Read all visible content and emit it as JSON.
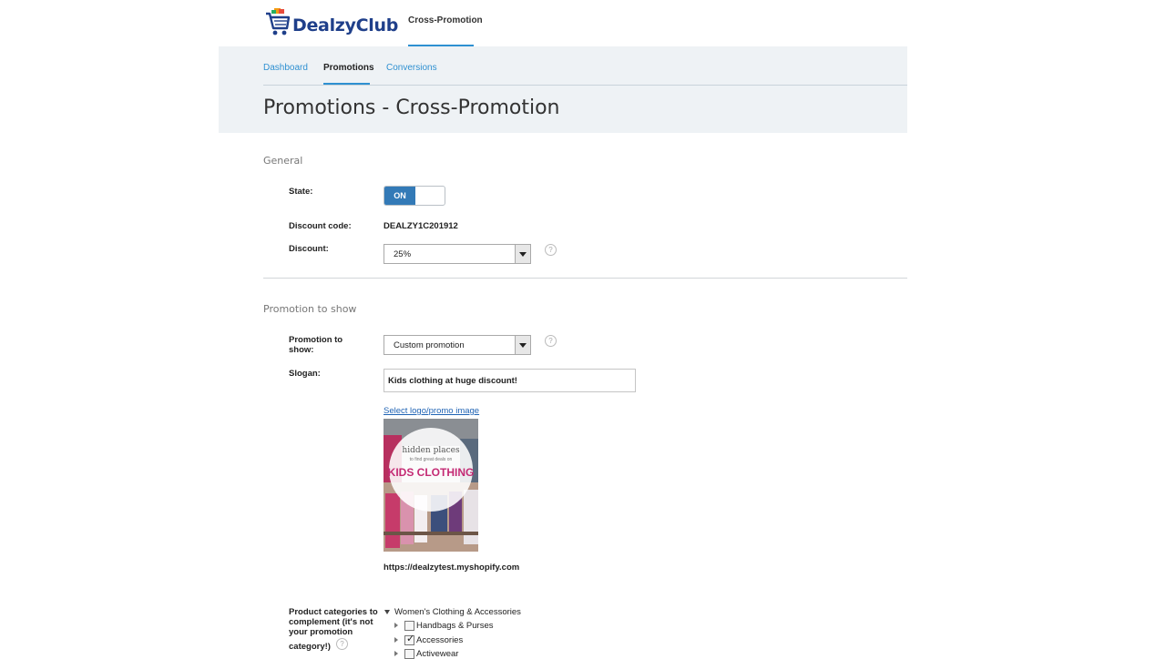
{
  "brand": {
    "name": "DealzyClub"
  },
  "top_nav": {
    "active_tab": "Cross-Promotion"
  },
  "sub_nav": {
    "items": [
      "Dashboard",
      "Promotions",
      "Conversions"
    ],
    "active_index": 1
  },
  "page": {
    "title": "Promotions - Cross-Promotion"
  },
  "general": {
    "section_title": "General",
    "state_label": "State:",
    "state_value": "ON",
    "discount_code_label": "Discount code:",
    "discount_code": "DEALZY1C201912",
    "discount_label": "Discount:",
    "discount_value": "25%",
    "help_glyph": "?"
  },
  "promotion": {
    "section_title": "Promotion to show",
    "promotion_label_line1": "Promotion to",
    "promotion_label_line2": "show:",
    "promotion_value": "Custom promotion",
    "slogan_label": "Slogan:",
    "slogan_value": "Kids clothing at huge discount!",
    "select_image_link": "Select logo/promo image",
    "image_text": {
      "line1": "hidden places",
      "line2": "to find great deals on",
      "line3": "KIDS CLOTHING"
    },
    "shop_url": "https://dealzytest.myshopify.com"
  },
  "categories": {
    "label_line1": "Product categories to",
    "label_line2_a": "complement (it's ",
    "label_line2_b": "not",
    "label_line3": "your promotion",
    "label_line4": "category!)",
    "tree": [
      {
        "label": "Women's Clothing & Accessories",
        "checked": false
      },
      {
        "label": "Handbags & Purses",
        "checked": false
      },
      {
        "label": "Accessories",
        "checked": true
      },
      {
        "label": "Activewear",
        "checked": false
      }
    ]
  },
  "colors": {
    "accent": "#2e90d1",
    "toggle_on": "#337ab7",
    "brand": "#1f3f8a",
    "banner_bg": "#eef2f5"
  },
  "icons": {
    "logo": "shopping-cart-icon",
    "help": "question-circle-icon",
    "dropdown": "triangle-down-icon",
    "tree_expand": "triangle-right-icon",
    "tree_collapse": "triangle-down-icon"
  }
}
